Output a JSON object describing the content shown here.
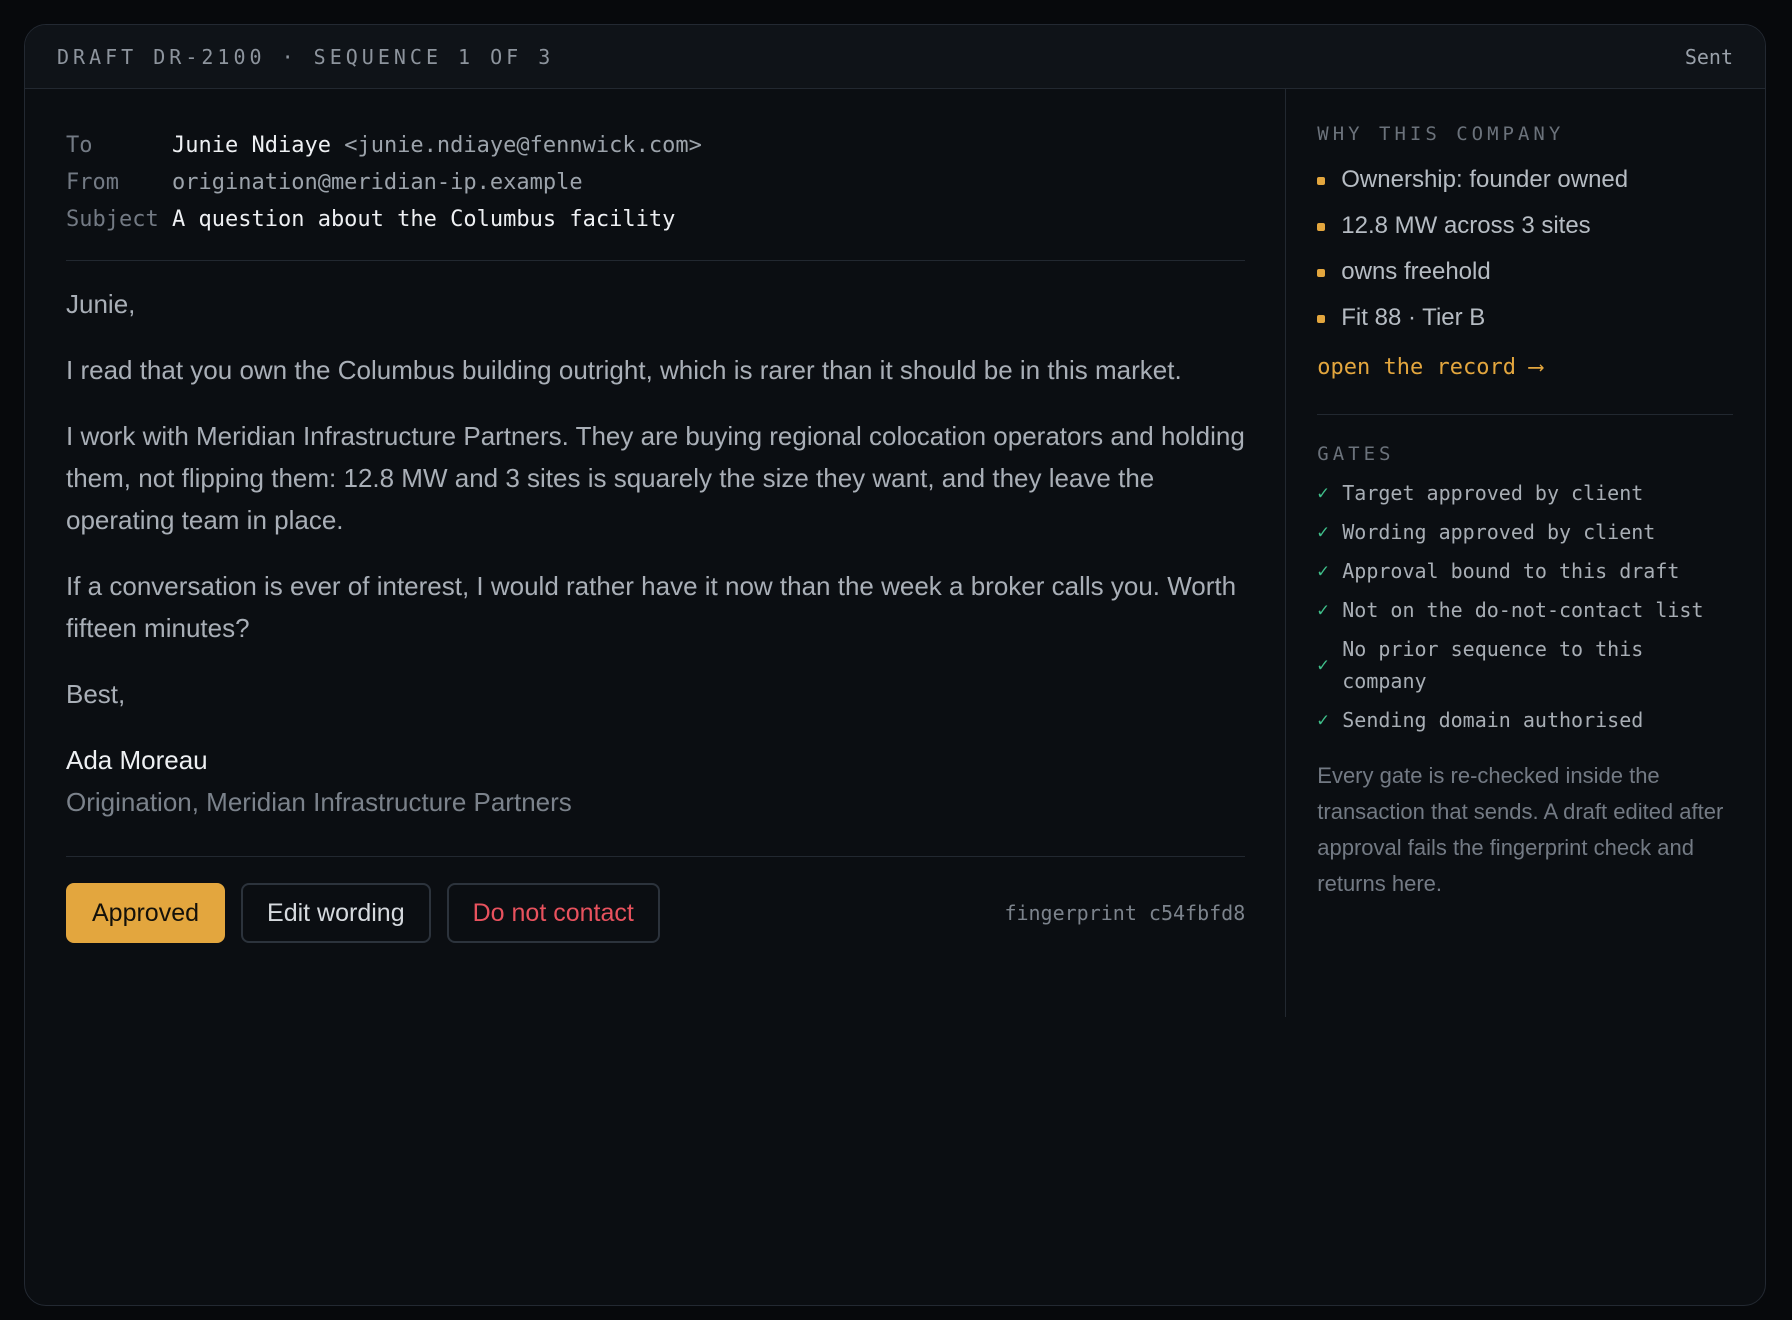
{
  "header": {
    "draft_title": "DRAFT DR-2100 · SEQUENCE 1 OF 3",
    "status": "Sent"
  },
  "email": {
    "to_label": "To",
    "to_name": "Junie Ndiaye",
    "to_address": "<junie.ndiaye@fennwick.com>",
    "from_label": "From",
    "from_value": "origination@meridian-ip.example",
    "subject_label": "Subject",
    "subject_value": "A question about the Columbus facility",
    "greeting": "Junie,",
    "paragraphs": [
      "I read that you own the Columbus building outright, which is rarer than it should be in this market.",
      "I work with Meridian Infrastructure Partners. They are buying regional colocation operators and holding them, not flipping them: 12.8 MW and 3 sites is squarely the size they want, and they leave the operating team in place.",
      "If a conversation is ever of interest, I would rather have it now than the week a broker calls you. Worth fifteen minutes?"
    ],
    "signoff": "Best,",
    "sig_name": "Ada Moreau",
    "sig_title": "Origination, Meridian Infrastructure Partners"
  },
  "actions": {
    "approved_label": "Approved",
    "edit_label": "Edit wording",
    "dnc_label": "Do not contact",
    "fingerprint": "fingerprint c54fbfd8"
  },
  "sidebar": {
    "why_heading": "WHY THIS COMPANY",
    "why_items": [
      "Ownership: founder owned",
      "12.8 MW across 3 sites",
      "owns freehold",
      "Fit 88 · Tier B"
    ],
    "open_record_label": "open the record ⟶",
    "gates_heading": "GATES",
    "gates": [
      "Target approved by client",
      "Wording approved by client",
      "Approval bound to this draft",
      "Not on the do-not-contact list",
      "No prior sequence to this company",
      "Sending domain authorised"
    ],
    "gate_check_glyph": "✓",
    "note": "Every gate is re-checked inside the transaction that sends. A draft edited after approval fails the fingerprint check and returns here."
  },
  "colors": {
    "accent": "#e3a63e",
    "danger": "#e8525e",
    "success": "#3fbf8a",
    "background": "#0b0e12"
  }
}
